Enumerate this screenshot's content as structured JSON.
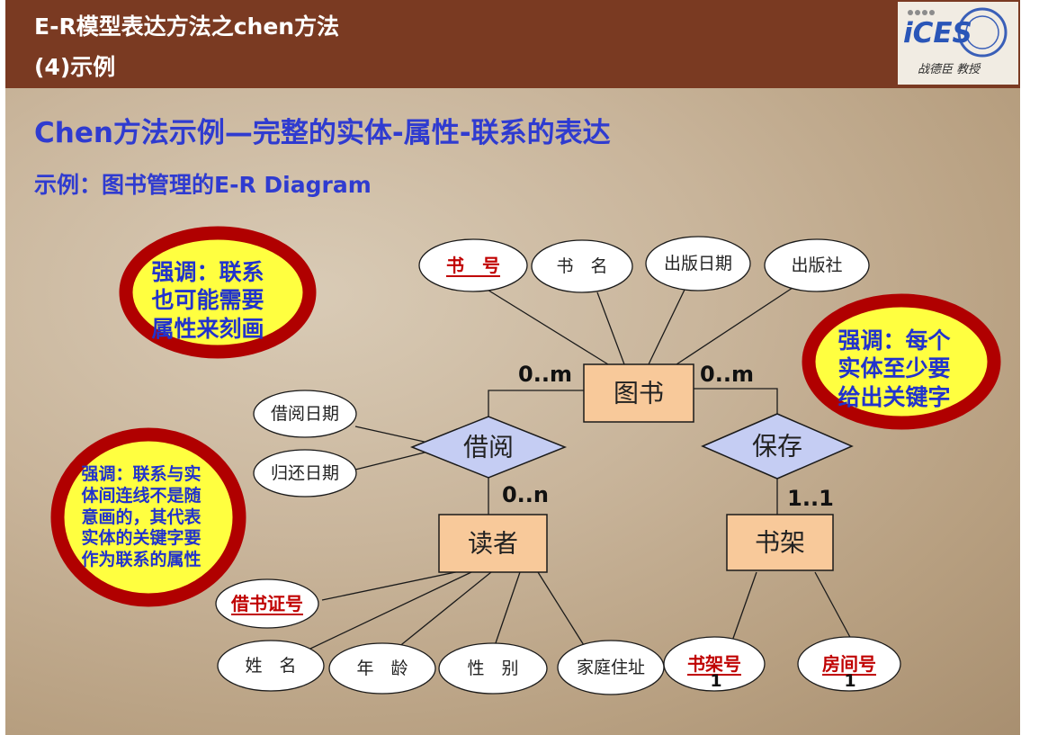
{
  "header": {
    "title_line1": "E-R模型表达方法之chen方法",
    "title_line2": "(4)示例",
    "logo_text": "iCES",
    "logo_subtitle": "战德臣 教授"
  },
  "slide": {
    "main_title": "Chen方法示例—完整的实体-属性-联系的表达",
    "subtitle": "示例：图书管理的E-R Diagram"
  },
  "diagram": {
    "entities": {
      "book": "图书",
      "reader": "读者",
      "shelf": "书架"
    },
    "relationships": {
      "borrow": "借阅",
      "store": "保存"
    },
    "attributes": {
      "book_no": "书　号",
      "book_name": "书　名",
      "publish_date": "出版日期",
      "publisher": "出版社",
      "borrow_date": "借阅日期",
      "return_date": "归还日期",
      "card_no": "借书证号",
      "name": "姓　名",
      "age": "年　龄",
      "gender": "性　别",
      "address": "家庭住址",
      "shelf_no": "书架号",
      "room_no": "房间号"
    },
    "cardinalities": {
      "book_borrow": "0..m",
      "book_store": "0..m",
      "borrow_reader": "0..n",
      "store_shelf": "1..1",
      "shelf_no": "1",
      "room_no": "1"
    }
  },
  "callouts": {
    "relationship_attrs": [
      "强调：联系",
      "也可能需要",
      "属性来刻画"
    ],
    "entity_key": [
      "强调：每个",
      "实体至少要",
      "给出关键字"
    ],
    "link_keys": [
      "强调：联系与实",
      "体间连线不是随",
      "意画的，其代表",
      "实体的关键字要",
      "作为联系的属性"
    ]
  },
  "colors": {
    "header_bg": "#7a3a22",
    "title": "#2f3bd0",
    "entity_fill": "#f8c99a",
    "relationship_fill": "#c5cdf3",
    "attribute_fill": "#ffffff",
    "key_text": "#c00000",
    "callout_ring": "#b00000",
    "callout_fill": "#ffff40",
    "callout_text": "#2233cc"
  }
}
